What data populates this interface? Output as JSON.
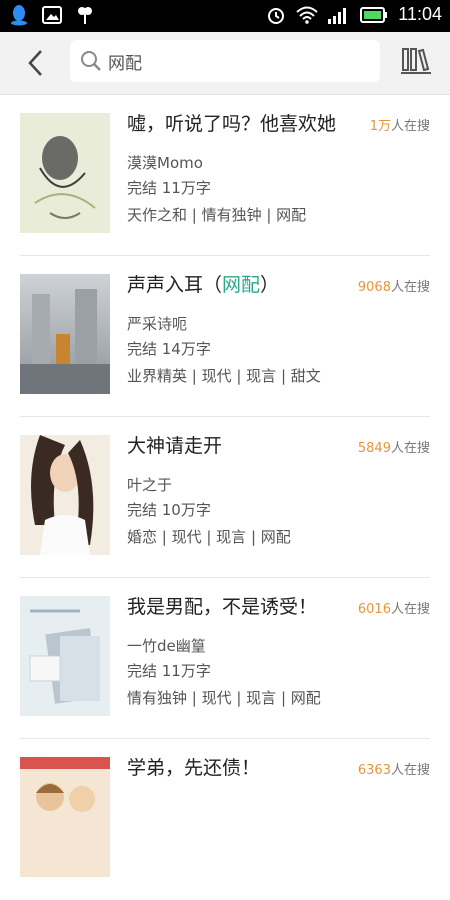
{
  "statusbar": {
    "time": "11:04"
  },
  "search": {
    "value": "网配",
    "placeholder": ""
  },
  "results": [
    {
      "title": "嘘，听说了吗？他喜欢她",
      "hl": "",
      "tail": "",
      "hot_num": "1万",
      "hot_suffix": "人在搜",
      "author": "漠漠Momo",
      "status": "完结  11万字",
      "tags": "天作之和 | 情有独钟 | 网配"
    },
    {
      "title": "声声入耳（",
      "hl": "网配",
      "tail": "）",
      "hot_num": "9068",
      "hot_suffix": "人在搜",
      "author": "严采诗呃",
      "status": "完结  14万字",
      "tags": "业界精英 | 现代 | 现言 | 甜文"
    },
    {
      "title": "大神请走开",
      "hl": "",
      "tail": "",
      "hot_num": "5849",
      "hot_suffix": "人在搜",
      "author": "叶之于",
      "status": "完结  10万字",
      "tags": "婚恋 | 现代 | 现言 | 网配"
    },
    {
      "title": "我是男配，不是诱受！",
      "hl": "",
      "tail": "",
      "hot_num": "6016",
      "hot_suffix": "人在搜",
      "author": "一竹de幽篁",
      "status": "完结  11万字",
      "tags": "情有独钟 | 现代 | 现言 | 网配"
    },
    {
      "title": "学弟，先还债！",
      "hl": "",
      "tail": "",
      "hot_num": "6363",
      "hot_suffix": "人在搜",
      "author": "",
      "status": "",
      "tags": ""
    }
  ],
  "colors": {
    "accent": "#2aa889",
    "hot": "#e8953a"
  }
}
